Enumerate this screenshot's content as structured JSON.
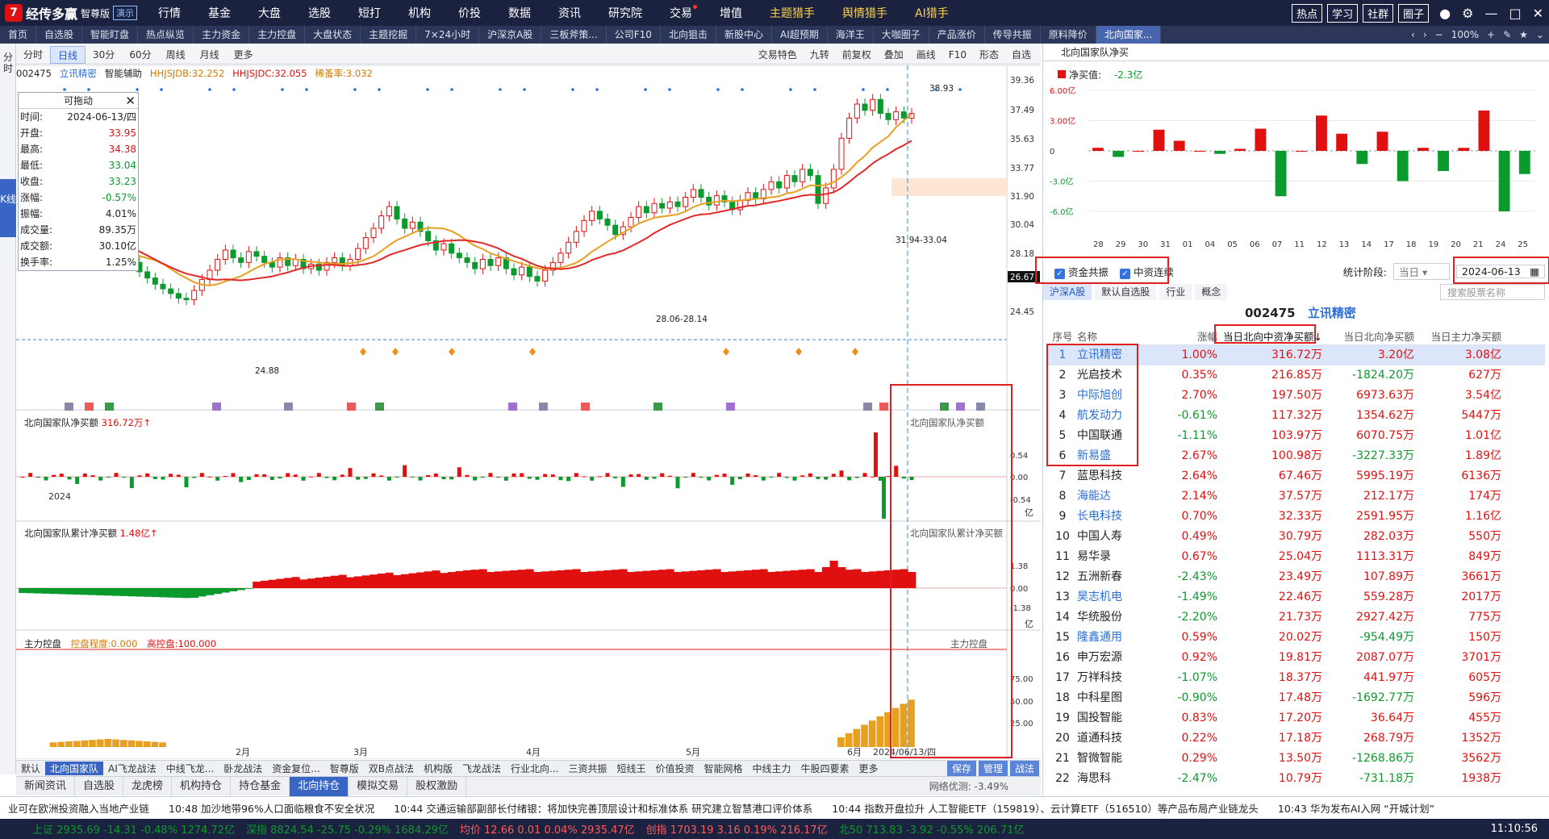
{
  "app": {
    "logo_glyph": "7",
    "name": "经传多赢",
    "edition": "智尊版",
    "demo": "演示"
  },
  "menu": [
    "行情",
    "基金",
    "大盘",
    "选股",
    "短打",
    "机构",
    "价投",
    "数据",
    "资讯",
    "研究院",
    "交易",
    "增值",
    "主题猎手",
    "舆情猎手",
    "AI猎手"
  ],
  "top_right": {
    "buttons": [
      "热点",
      "学习",
      "社群",
      "圈子"
    ]
  },
  "tabs": [
    "首页",
    "自选股",
    "智能盯盘",
    "热点纵览",
    "主力资金",
    "主力控盘",
    "大盘状态",
    "主题挖掘",
    "7×24小时",
    "沪深京A股",
    "三板斧策...",
    "公司F10",
    "北向狙击",
    "新股中心",
    "AI超预期",
    "海洋王",
    "大咖圈子",
    "产品涨价",
    "传导共振",
    "原料降价",
    "北向国家..."
  ],
  "zoom": "100%",
  "left_strip": {
    "fenshi": "分时",
    "kline": "K线"
  },
  "chart_toolbar": {
    "left": [
      "分时",
      "日线",
      "30分",
      "60分",
      "周线",
      "月线",
      "更多"
    ],
    "right": [
      "交易特色",
      "九转",
      "前复权",
      "叠加",
      "画线",
      "F10",
      "形态",
      "自选"
    ]
  },
  "info_bar": {
    "code": "002475",
    "name": "立讯精密",
    "assist": "智能辅助",
    "hj1": "HHJSJDB:32.252",
    "hj2": "HHJSJDC:32.055",
    "qh": "稀蚤率:3.032"
  },
  "float_box": {
    "title": "可拖动",
    "rows": [
      {
        "k": "时间:",
        "v": "2024-06-13/四",
        "c": ""
      },
      {
        "k": "开盘:",
        "v": "33.95",
        "c": "up"
      },
      {
        "k": "最高:",
        "v": "34.38",
        "c": "up"
      },
      {
        "k": "最低:",
        "v": "33.04",
        "c": "dn"
      },
      {
        "k": "收盘:",
        "v": "33.23",
        "c": "dn"
      },
      {
        "k": "涨幅:",
        "v": "-0.57%",
        "c": "dn"
      },
      {
        "k": "振幅:",
        "v": "4.01%",
        "c": ""
      },
      {
        "k": "成交量:",
        "v": "89.35万",
        "c": ""
      },
      {
        "k": "成交额:",
        "v": "30.10亿",
        "c": ""
      },
      {
        "k": "换手率:",
        "v": "1.25%",
        "c": ""
      }
    ]
  },
  "kchart": {
    "y_ticks": [
      "39.36",
      "37.49",
      "35.63",
      "33.77",
      "31.90",
      "30.04",
      "28.18",
      "26.67",
      "24.45"
    ],
    "annotations": [
      "38.93",
      "24.88",
      "28.06-28.14",
      "31.94-33.04"
    ],
    "x_labels": [
      "2024",
      "2月",
      "3月",
      "4月",
      "5月",
      "6月",
      "2024/06/13/四"
    ],
    "closes": [
      30.8,
      30.4,
      30.1,
      29.8,
      29.2,
      28.6,
      28.0,
      27.6,
      28.3,
      28.8,
      28.5,
      27.9,
      28.4,
      28.1,
      27.6,
      27.0,
      26.6,
      26.2,
      25.9,
      25.6,
      25.3,
      25.2,
      25.8,
      26.5,
      27.1,
      27.8,
      28.4,
      27.9,
      27.6,
      28.3,
      28.0,
      27.6,
      27.3,
      27.9,
      27.4,
      27.8,
      27.2,
      27.5,
      27.1,
      27.6,
      27.9,
      27.4,
      27.8,
      28.5,
      29.2,
      29.8,
      30.6,
      31.2,
      30.4,
      29.8,
      30.2,
      29.6,
      29.0,
      28.4,
      28.8,
      28.2,
      27.9,
      27.6,
      27.2,
      27.8,
      27.4,
      27.9,
      27.2,
      26.8,
      27.3,
      26.7,
      26.4,
      27.1,
      27.6,
      28.2,
      28.9,
      29.6,
      30.3,
      30.9,
      30.4,
      30.0,
      29.4,
      29.9,
      30.5,
      31.2,
      30.8,
      31.4,
      31.1,
      31.5,
      31.2,
      31.8,
      32.3,
      31.8,
      31.3,
      31.9,
      31.5,
      31.0,
      31.6,
      32.1,
      31.7,
      32.3,
      32.8,
      32.4,
      33.2,
      32.8,
      33.6,
      33.2,
      31.4,
      32.4,
      33.6,
      35.6,
      36.9,
      37.8,
      37.4,
      38.1,
      37.2,
      36.8,
      37.3,
      36.9,
      37.2
    ]
  },
  "panels": {
    "net_buy": {
      "title": "北向国家队净买额",
      "value": "316.72万",
      "right_title": "北向国家队净买额",
      "ticks": [
        "0.54",
        "0.00",
        "-0.54"
      ],
      "unit": "亿"
    },
    "cum_buy": {
      "title": "北向国家队累计净买额",
      "value": "1.48亿",
      "right_title": "北向国家队累计净买额",
      "ticks": [
        "1.38",
        "0.00",
        "-1.38"
      ],
      "unit": "亿"
    },
    "control": {
      "title": "主力控盘",
      "l1": "控盘程度:0.000",
      "l2": "高控盘:100.000",
      "right_title": "主力控盘",
      "ticks": [
        "75.00",
        "50.00",
        "25.00"
      ]
    }
  },
  "bottom_tabs": [
    "默认",
    "北向国家队",
    "AI飞龙战法",
    "中线飞龙...",
    "卧龙战法",
    "资金复位...",
    "智尊版",
    "双B点战法",
    "机构版",
    "飞龙战法",
    "行业北向...",
    "三资共振",
    "短线王",
    "价值投资",
    "智能网格",
    "中线主力",
    "牛股四要素",
    "更多"
  ],
  "bottom_tabs_right": [
    "保存",
    "管理",
    "战法"
  ],
  "mid_tabs": [
    "新闻资讯",
    "自选股",
    "龙虎榜",
    "机构持仓",
    "持仓基金",
    "北向持仓",
    "模拟交易",
    "股权激励"
  ],
  "network": "网络优测: -3.49%",
  "news": [
    "业可在欧洲投资融入当地产业链",
    "10:48 加沙地带96%人口面临粮食不安全状况",
    "10:44 交通运输部副部长付绪银：将加快完善顶层设计和标准体系 研究建立智慧港口评价体系",
    "10:44 指数开盘拉升 人工智能ETF（159819）、云计算ETF（516510）等产品布局产业链龙头",
    "10:43 华为发布AI入网 “开城计划”"
  ],
  "status": {
    "sh": "上证 2935.69 -14.31 -0.48% 1274.72亿",
    "sz": "深指 8824.54 -25.75 -0.29% 1684.29亿",
    "avg": "均价 12.66 0.01 0.04% 2935.47亿",
    "cy": "创指 1703.19 3.16 0.19% 216.17亿",
    "b50": "北50 713.83 -3.92 -0.55% 206.71亿",
    "time": "11:10:56"
  },
  "right": {
    "title": "北向国家队净买",
    "legend": "净买值:",
    "legend_val": "-2.3亿",
    "bar_ticks": [
      "6.00亿",
      "3.00亿",
      "0",
      "-3.0亿",
      "-6.0亿"
    ],
    "bar_dates": [
      "28",
      "29",
      "30",
      "31",
      "01",
      "04",
      "05",
      "06",
      "07",
      "11",
      "12",
      "13",
      "14",
      "17",
      "18",
      "19",
      "20",
      "21",
      "24",
      "25"
    ],
    "bar_values": [
      0.3,
      -0.6,
      0,
      2.1,
      1.0,
      0,
      -0.3,
      0.2,
      2.2,
      -4.5,
      0,
      3.5,
      1.7,
      -1.3,
      1.9,
      -3.0,
      0.3,
      -2.0,
      0.3,
      4.0,
      -6.0,
      -2.3
    ],
    "filter": {
      "c1": "资金共振",
      "c2": "中资连续",
      "period_label": "统计阶段:",
      "period": "当日",
      "date": "2024-06-13"
    },
    "subtabs": [
      "沪深A股",
      "默认自选股",
      "行业",
      "概念"
    ],
    "search_placeholder": "搜索股票名称",
    "stock": {
      "code": "002475",
      "name": "立讯精密"
    },
    "headers": [
      "序号",
      "名称",
      "涨幅",
      "当日北向中资净买额↓",
      "当日北向净买额",
      "当日主力净买额"
    ],
    "rows": [
      [
        "1",
        "立讯精密",
        "1.00%",
        "316.72万",
        "3.20亿",
        "3.08亿"
      ],
      [
        "2",
        "光启技术",
        "0.35%",
        "216.85万",
        "-1824.20万",
        "627万"
      ],
      [
        "3",
        "中际旭创",
        "2.70%",
        "197.50万",
        "6973.63万",
        "3.54亿"
      ],
      [
        "4",
        "航发动力",
        "-0.61%",
        "117.32万",
        "1354.62万",
        "5447万"
      ],
      [
        "5",
        "中国联通",
        "-1.11%",
        "103.97万",
        "6070.75万",
        "1.01亿"
      ],
      [
        "6",
        "新易盛",
        "2.67%",
        "100.98万",
        "-3227.33万",
        "1.89亿"
      ],
      [
        "7",
        "蓝思科技",
        "2.64%",
        "67.46万",
        "5995.19万",
        "6136万"
      ],
      [
        "8",
        "海能达",
        "2.14%",
        "37.57万",
        "212.17万",
        "174万"
      ],
      [
        "9",
        "长电科技",
        "0.70%",
        "32.33万",
        "2591.95万",
        "1.16亿"
      ],
      [
        "10",
        "中国人寿",
        "0.49%",
        "30.79万",
        "282.03万",
        "550万"
      ],
      [
        "11",
        "易华录",
        "0.67%",
        "25.04万",
        "1113.31万",
        "849万"
      ],
      [
        "12",
        "五洲新春",
        "-2.43%",
        "23.49万",
        "107.89万",
        "3661万"
      ],
      [
        "13",
        "昊志机电",
        "-1.49%",
        "22.46万",
        "559.28万",
        "2017万"
      ],
      [
        "14",
        "华统股份",
        "-2.20%",
        "21.73万",
        "2927.42万",
        "775万"
      ],
      [
        "15",
        "隆鑫通用",
        "0.59%",
        "20.02万",
        "-954.49万",
        "150万"
      ],
      [
        "16",
        "申万宏源",
        "0.92%",
        "19.81万",
        "2087.07万",
        "3701万"
      ],
      [
        "17",
        "万祥科技",
        "-1.07%",
        "18.37万",
        "441.97万",
        "605万"
      ],
      [
        "18",
        "中科星图",
        "-0.90%",
        "17.48万",
        "-1692.77万",
        "596万"
      ],
      [
        "19",
        "国投智能",
        "0.83%",
        "17.20万",
        "36.64万",
        "455万"
      ],
      [
        "20",
        "道通科技",
        "0.22%",
        "17.18万",
        "268.79万",
        "1352万"
      ],
      [
        "21",
        "智微智能",
        "0.29%",
        "13.50万",
        "-1268.86万",
        "3562万"
      ],
      [
        "22",
        "海思科",
        "-2.47%",
        "10.79万",
        "-731.18万",
        "1938万"
      ]
    ]
  }
}
